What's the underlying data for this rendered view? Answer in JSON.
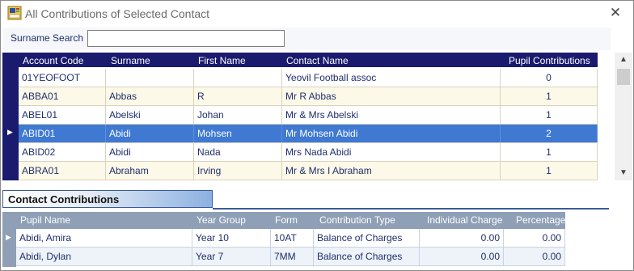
{
  "window": {
    "title": "All Contributions of Selected Contact",
    "close_glyph": "✕"
  },
  "search": {
    "label": "Surname Search",
    "value": ""
  },
  "contacts": {
    "headers": [
      "Account Code",
      "Surname",
      "First Name",
      "Contact Name",
      "Pupil Contributions"
    ],
    "rows": [
      {
        "account_code": "01YEOFOOT",
        "surname": "",
        "first_name": "",
        "contact_name": "Yeovil Football assoc",
        "pupil_contributions": "0"
      },
      {
        "account_code": "ABBA01",
        "surname": "Abbas",
        "first_name": "R",
        "contact_name": "Mr R Abbas",
        "pupil_contributions": "1"
      },
      {
        "account_code": "ABEL01",
        "surname": "Abelski",
        "first_name": "Johan",
        "contact_name": "Mr & Mrs  Abelski",
        "pupil_contributions": "1"
      },
      {
        "account_code": "ABID01",
        "surname": "Abidi",
        "first_name": "Mohsen",
        "contact_name": "Mr Mohsen Abidi",
        "pupil_contributions": "2"
      },
      {
        "account_code": "ABID02",
        "surname": "Abidi",
        "first_name": "Nada",
        "contact_name": "Mrs Nada Abidi",
        "pupil_contributions": "1"
      },
      {
        "account_code": "ABRA01",
        "surname": "Abraham",
        "first_name": "Irving",
        "contact_name": "Mr & Mrs I Abraham",
        "pupil_contributions": "1"
      }
    ],
    "selected_row": 3
  },
  "contributions": {
    "section_title": "Contact Contributions",
    "headers": [
      "Pupil Name",
      "Year Group",
      "Form",
      "Contribution Type",
      "Individual Charge",
      "Percentage"
    ],
    "rows": [
      {
        "pupil_name": "Abidi, Amira",
        "year_group": "Year 10",
        "form": "10AT",
        "contribution_type": "Balance of Charges",
        "individual_charge": "0.00",
        "percentage": "0.00"
      },
      {
        "pupil_name": "Abidi, Dylan",
        "year_group": "Year 7",
        "form": "7MM",
        "contribution_type": "Balance of Charges",
        "individual_charge": "0.00",
        "percentage": "0.00"
      }
    ]
  },
  "colors": {
    "grid_header": "#1a1a6e",
    "selected_row": "#3f79d2",
    "alt_row": "#fdf9e9",
    "subgrid_header": "#8e9fb6"
  },
  "icons": {
    "app": "contacts-app-icon",
    "close": "close-icon",
    "scroll_up": "scroll-up-icon",
    "scroll_down": "scroll-down-icon",
    "row_pointer": "row-pointer-icon"
  }
}
